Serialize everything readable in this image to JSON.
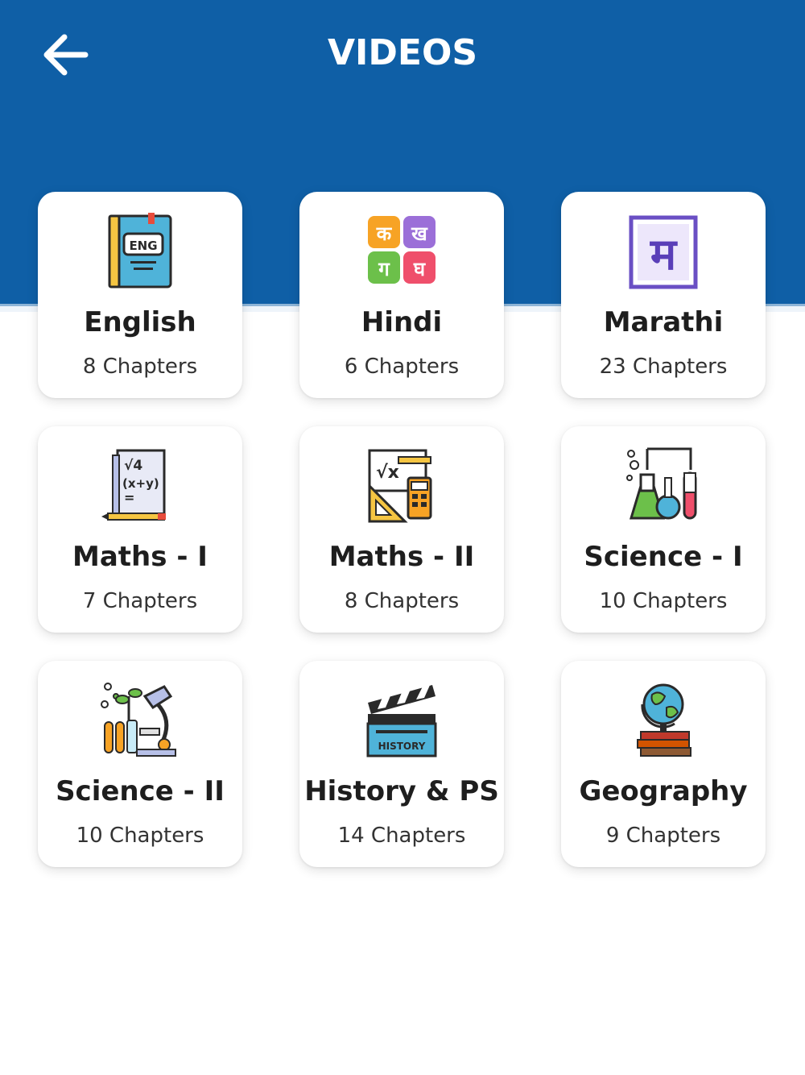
{
  "header": {
    "title": "VIDEOS",
    "back_icon": "arrow-left-icon",
    "background_color": "#0f5fa6"
  },
  "subjects": [
    {
      "name": "English",
      "chapters": "8 Chapters",
      "icon": "english-book-icon"
    },
    {
      "name": "Hindi",
      "chapters": "6 Chapters",
      "icon": "hindi-letters-icon"
    },
    {
      "name": "Marathi",
      "chapters": "23 Chapters",
      "icon": "marathi-letter-icon"
    },
    {
      "name": "Maths - I",
      "chapters": "7 Chapters",
      "icon": "maths-paper-icon"
    },
    {
      "name": "Maths - II",
      "chapters": "8 Chapters",
      "icon": "geometry-tools-icon"
    },
    {
      "name": "Science - I",
      "chapters": "10 Chapters",
      "icon": "lab-flasks-icon"
    },
    {
      "name": "Science - II",
      "chapters": "10 Chapters",
      "icon": "microscope-plant-icon"
    },
    {
      "name": "History & PS",
      "chapters": "14 Chapters",
      "icon": "history-clapperboard-icon"
    },
    {
      "name": "Geography",
      "chapters": "9 Chapters",
      "icon": "globe-books-icon"
    }
  ],
  "icon_text": {
    "eng_label": "ENG",
    "hindi_letters": [
      "क",
      "ख",
      "ग",
      "घ"
    ],
    "marathi_letter": "म",
    "maths_line1": "√4",
    "maths_line2": "(x+y)",
    "maths_line3": "=",
    "geometry_symbol": "√x",
    "history_label": "HISTORY"
  }
}
